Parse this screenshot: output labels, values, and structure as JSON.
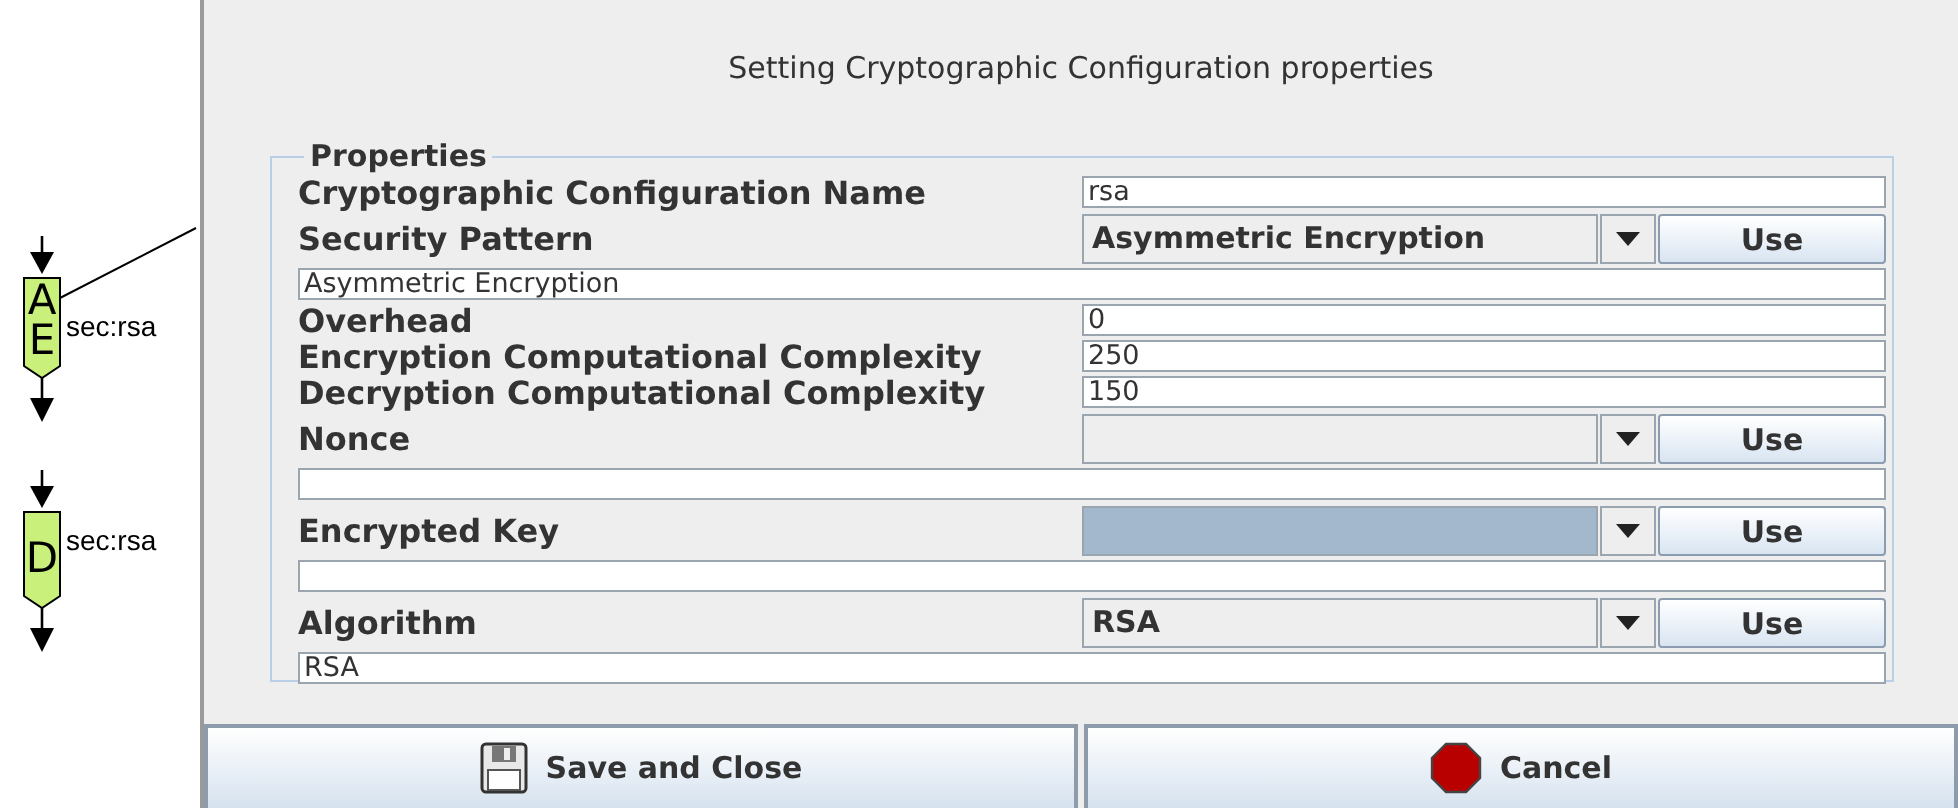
{
  "diagram": {
    "nodes": [
      {
        "symbol_lines": [
          "A",
          "E"
        ],
        "label": "sec:rsa",
        "linked": true
      },
      {
        "symbol_lines": [
          "D"
        ],
        "label": "sec:rsa",
        "linked": false
      }
    ]
  },
  "dialog": {
    "title": "Setting Cryptographic Configuration properties",
    "group": {
      "title": "Properties",
      "rows": [
        {
          "kind": "text",
          "label": "Cryptographic Configuration Name",
          "value": "rsa"
        },
        {
          "kind": "combo",
          "label": "Security Pattern",
          "selection": "Asymmetric Encryption",
          "highlighted": false,
          "button": "Use",
          "detail": "Asymmetric Encryption"
        },
        {
          "kind": "text",
          "label": "Overhead",
          "value": "0"
        },
        {
          "kind": "text",
          "label": "Encryption Computational Complexity",
          "value": "250"
        },
        {
          "kind": "text",
          "label": "Decryption Computational Complexity",
          "value": "150"
        },
        {
          "kind": "combo",
          "label": "Nonce",
          "selection": "",
          "highlighted": false,
          "button": "Use",
          "detail": ""
        },
        {
          "kind": "combo",
          "label": "Encrypted Key",
          "selection": "",
          "highlighted": true,
          "button": "Use",
          "detail": ""
        },
        {
          "kind": "combo",
          "label": "Algorithm",
          "selection": "RSA",
          "highlighted": false,
          "button": "Use",
          "detail": "RSA"
        }
      ]
    },
    "buttons": [
      {
        "kind": "save",
        "label": "Save and Close"
      },
      {
        "kind": "cancel",
        "label": "Cancel"
      }
    ]
  }
}
